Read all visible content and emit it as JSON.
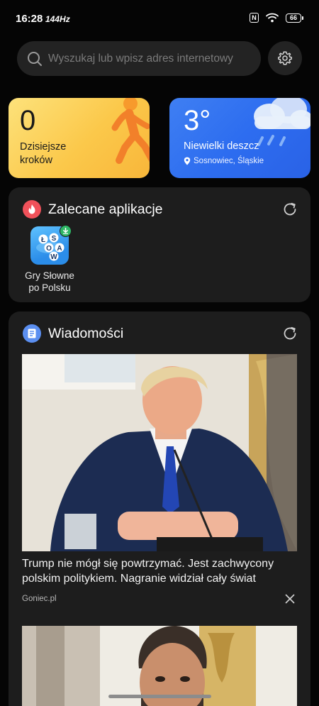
{
  "status_bar": {
    "time": "16:28",
    "refresh_rate": "144Hz",
    "battery": "66",
    "icons": [
      "nfc-icon",
      "wifi-icon",
      "battery-icon"
    ]
  },
  "search": {
    "placeholder": "Wyszukaj lub wpisz adres internetowy",
    "icon": "search-icon"
  },
  "settings": {
    "icon": "gear-icon"
  },
  "steps_widget": {
    "count": "0",
    "label": "Dzisiejsze kroków",
    "icon": "walking-person-icon",
    "color": "#fbc84a"
  },
  "weather_widget": {
    "temperature": "3°",
    "description": "Niewielki deszcz",
    "location": "Sosnowiec, Śląskie",
    "icon": "rain-cloud-icon",
    "color": "#2d6df0"
  },
  "recommended": {
    "title": "Zalecane aplikacje",
    "icon": "fire-icon",
    "apps": [
      {
        "name": "Gry Słowne po Polsku",
        "letters": [
          "Ł",
          "S",
          "O",
          "A",
          "W"
        ],
        "badge": "download-icon"
      }
    ]
  },
  "news": {
    "title": "Wiadomości",
    "icon": "news-icon",
    "articles": [
      {
        "headline": "Trump nie mógł się powtrzymać. Jest zachwycony polskim politykiem. Nagranie widział cały świat",
        "source": "Goniec.pl"
      }
    ]
  }
}
